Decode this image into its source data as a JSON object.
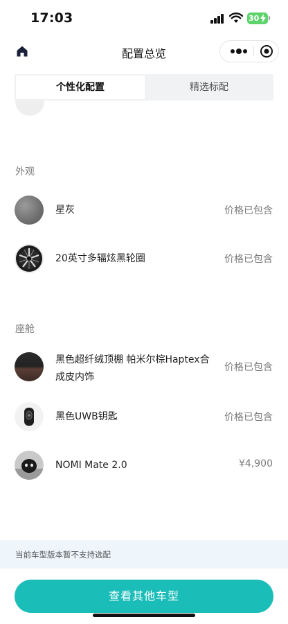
{
  "status_bar": {
    "time": "17:03",
    "battery": "30"
  },
  "nav": {
    "title": "配置总览",
    "icons": [
      "home-icon",
      "more-dots-icon",
      "target-icon"
    ]
  },
  "tabs": [
    {
      "label": "个性化配置",
      "active": true
    },
    {
      "label": "精选标配",
      "active": false
    }
  ],
  "sections": [
    {
      "title": "外观",
      "items": [
        {
          "name": "星灰",
          "price": "价格已包含",
          "thumb": "grey-paint-swatch"
        },
        {
          "name": "20英寸多辐炫黑轮圈",
          "price": "价格已包含",
          "thumb": "wheel-image"
        }
      ]
    },
    {
      "title": "座舱",
      "items": [
        {
          "name": "黑色超纤绒顶棚 帕米尔棕Haptex合成皮内饰",
          "price": "价格已包含",
          "thumb": "interior-image"
        },
        {
          "name": "黑色UWB钥匙",
          "price": "价格已包含",
          "thumb": "key-image"
        },
        {
          "name": "NOMI Mate 2.0",
          "price": "¥4,900",
          "thumb": "nomi-image"
        }
      ]
    }
  ],
  "notice": "当前车型版本暂不支持选配",
  "cta": "查看其他车型",
  "colors": {
    "accent": "#1bbdb8",
    "notice_bg": "#eef6fc",
    "battery": "#5dd36b"
  }
}
